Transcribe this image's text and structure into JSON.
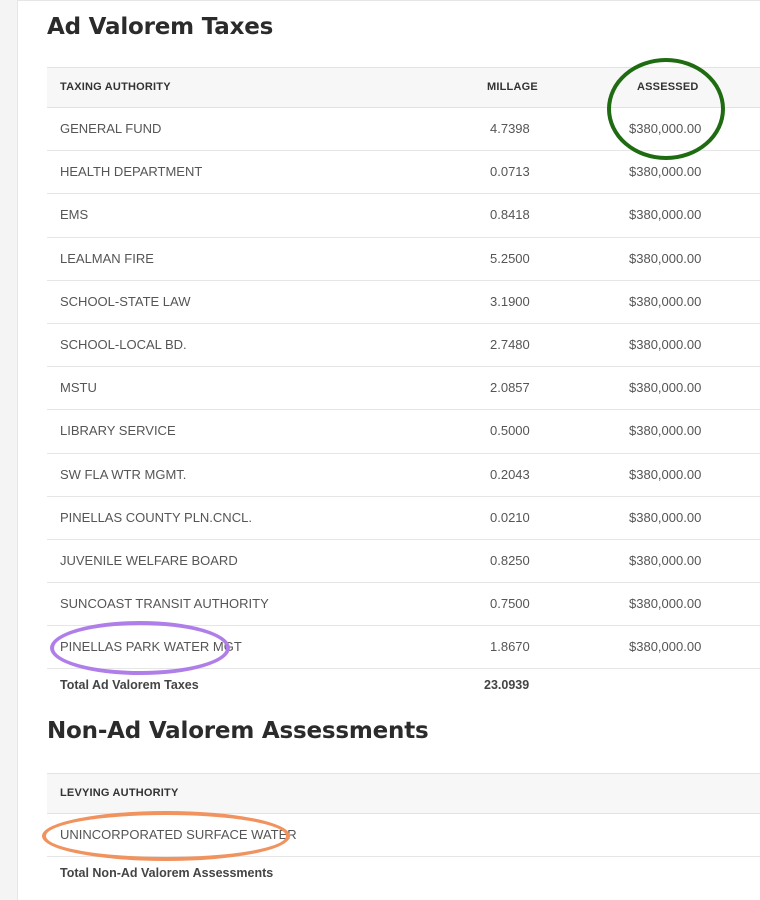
{
  "ad_valorem": {
    "title": "Ad Valorem Taxes",
    "headers": {
      "authority": "TAXING AUTHORITY",
      "millage": "MILLAGE",
      "assessed": "ASSESSED"
    },
    "rows": [
      {
        "authority": "GENERAL FUND",
        "millage": "4.7398",
        "assessed": "$380,000.00"
      },
      {
        "authority": "HEALTH DEPARTMENT",
        "millage": "0.0713",
        "assessed": "$380,000.00"
      },
      {
        "authority": "EMS",
        "millage": "0.8418",
        "assessed": "$380,000.00"
      },
      {
        "authority": "LEALMAN FIRE",
        "millage": "5.2500",
        "assessed": "$380,000.00"
      },
      {
        "authority": "SCHOOL-STATE LAW",
        "millage": "3.1900",
        "assessed": "$380,000.00"
      },
      {
        "authority": "SCHOOL-LOCAL BD.",
        "millage": "2.7480",
        "assessed": "$380,000.00"
      },
      {
        "authority": "MSTU",
        "millage": "2.0857",
        "assessed": "$380,000.00"
      },
      {
        "authority": "LIBRARY SERVICE",
        "millage": "0.5000",
        "assessed": "$380,000.00"
      },
      {
        "authority": "SW FLA WTR MGMT.",
        "millage": "0.2043",
        "assessed": "$380,000.00"
      },
      {
        "authority": "PINELLAS COUNTY PLN.CNCL.",
        "millage": "0.0210",
        "assessed": "$380,000.00"
      },
      {
        "authority": "JUVENILE WELFARE BOARD",
        "millage": "0.8250",
        "assessed": "$380,000.00"
      },
      {
        "authority": "SUNCOAST TRANSIT AUTHORITY",
        "millage": "0.7500",
        "assessed": "$380,000.00"
      },
      {
        "authority": "PINELLAS PARK WATER MGT",
        "millage": "1.8670",
        "assessed": "$380,000.00"
      }
    ],
    "total_label": "Total Ad Valorem Taxes",
    "total_millage": "23.0939"
  },
  "non_ad_valorem": {
    "title": "Non-Ad Valorem Assessments",
    "headers": {
      "authority": "LEVYING AUTHORITY"
    },
    "rows": [
      {
        "authority": "UNINCORPORATED SURFACE WATER"
      }
    ],
    "total_label": "Total Non-Ad Valorem Assessments"
  },
  "annotations": {
    "assessed_ring_color": "#1f6b12",
    "pinellas_ring_color": "#b07ee8",
    "surface_water_ring_color": "#f0935f"
  }
}
